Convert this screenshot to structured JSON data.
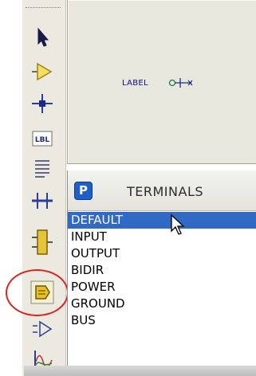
{
  "preview": {
    "label_text": "LABEL"
  },
  "terminals_panel": {
    "badge": "P",
    "title": "TERMINALS",
    "items": [
      {
        "label": "DEFAULT",
        "selected": true
      },
      {
        "label": "INPUT",
        "selected": false
      },
      {
        "label": "OUTPUT",
        "selected": false
      },
      {
        "label": "BIDIR",
        "selected": false
      },
      {
        "label": "POWER",
        "selected": false
      },
      {
        "label": "GROUND",
        "selected": false
      },
      {
        "label": "BUS",
        "selected": false
      }
    ]
  },
  "toolbar": {
    "tools": [
      {
        "icon": "selection-arrow-icon"
      },
      {
        "icon": "component-icon"
      },
      {
        "icon": "junction-dot-icon"
      },
      {
        "icon": "wire-label-icon",
        "text": "LBL"
      },
      {
        "icon": "text-script-icon"
      },
      {
        "icon": "buses-icon"
      },
      {
        "icon": "subcircuit-icon"
      },
      {
        "icon": "terminals-mode-icon",
        "highlighted": true
      },
      {
        "icon": "device-pin-icon"
      },
      {
        "icon": "graph-icon"
      }
    ]
  },
  "colors": {
    "selection": "#316ac5",
    "badge": "#1d5fcb",
    "highlight_ring": "#e02020",
    "preview_text": "#0a0a96"
  }
}
